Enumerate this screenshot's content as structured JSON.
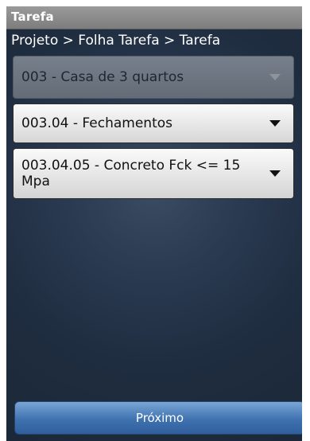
{
  "window": {
    "title": "Tarefa"
  },
  "breadcrumb": "Projeto > Folha Tarefa > Tarefa",
  "spinners": [
    {
      "value": "003 - Casa de 3 quartos",
      "enabled": false
    },
    {
      "value": "003.04 - Fechamentos",
      "enabled": true
    },
    {
      "value": "003.04.05 - Concreto Fck <= 15 Mpa",
      "enabled": true
    }
  ],
  "next_button": {
    "label": "Próximo"
  },
  "colors": {
    "title_bar": "#8a8a8a",
    "background": "#243349",
    "button_blue": "#3f72b0"
  },
  "icons": {
    "dropdown": "chevron-down-icon"
  }
}
